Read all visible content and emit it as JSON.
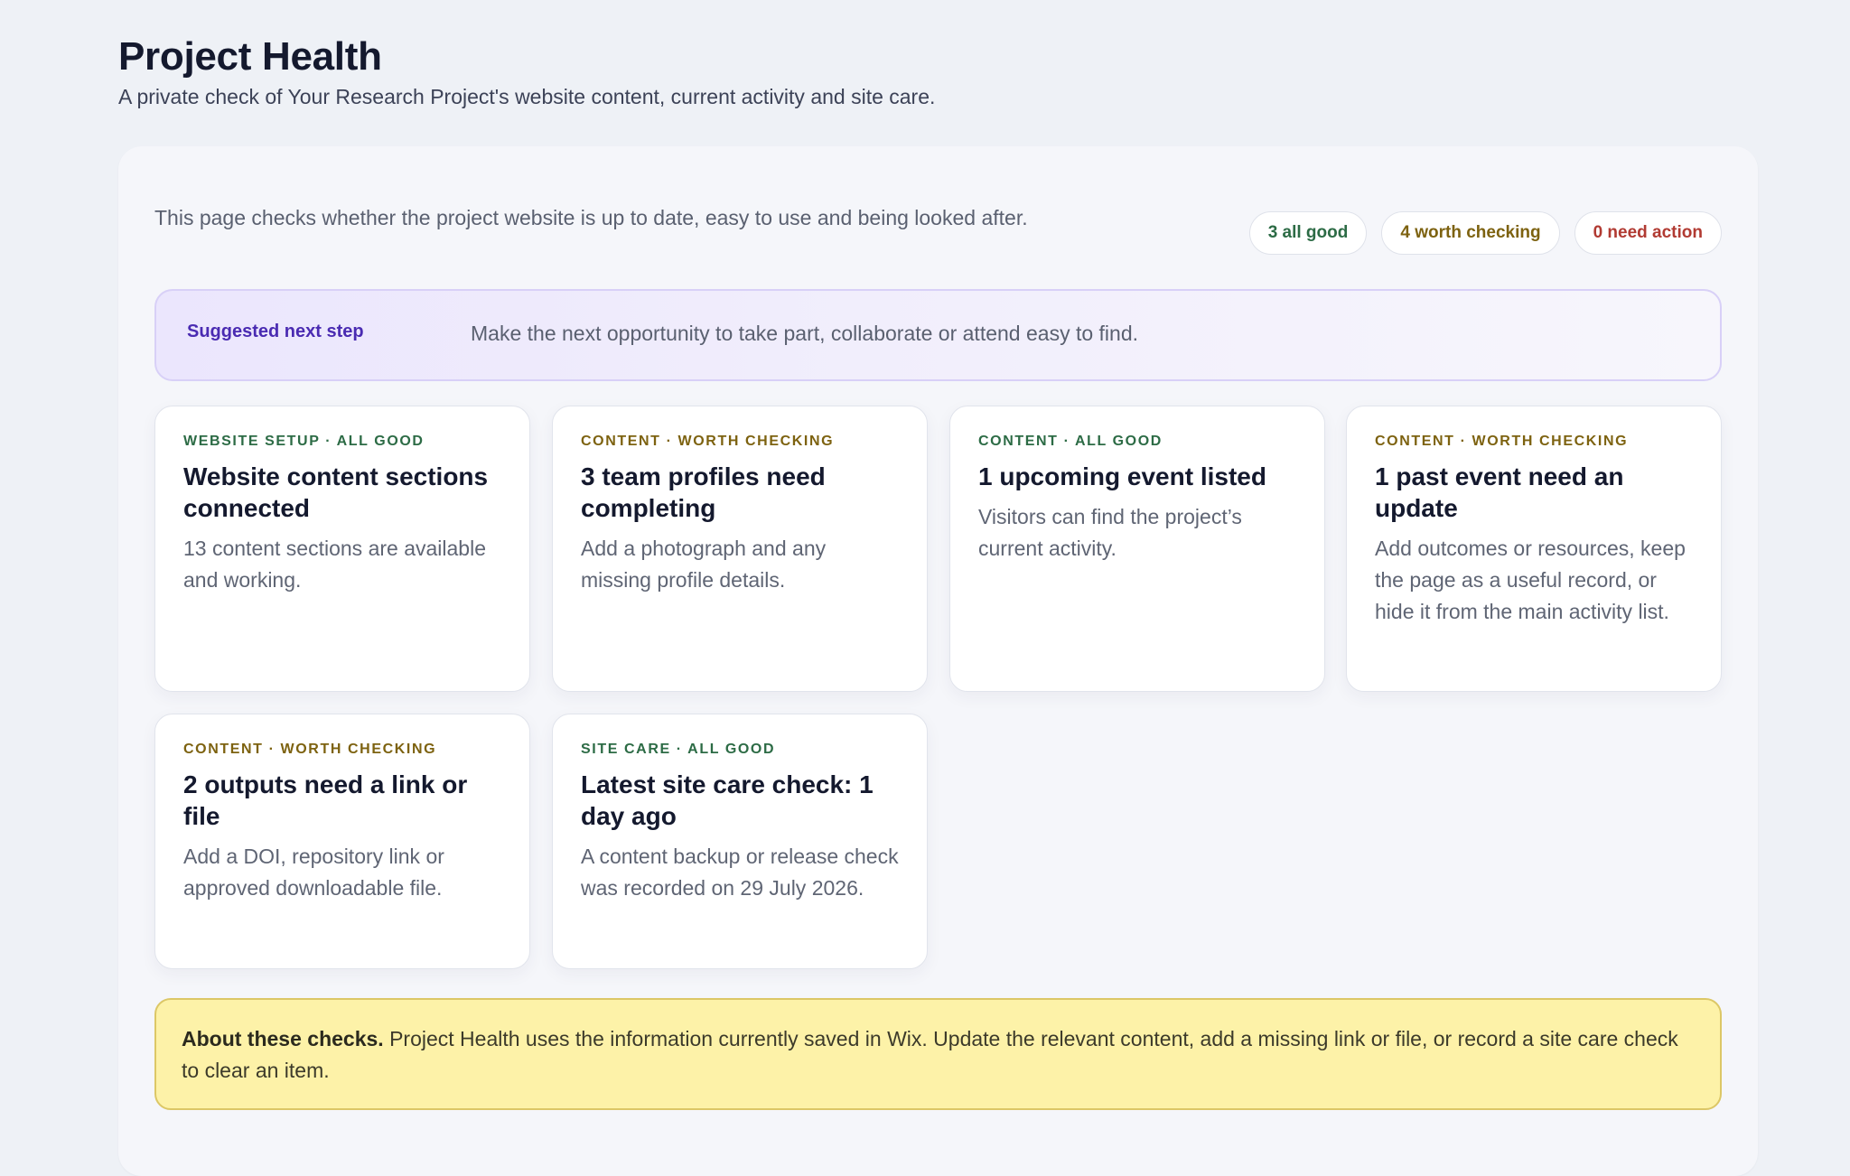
{
  "header": {
    "title": "Project Health",
    "subtitle": "A private check of Your Research Project's website content, current activity and site care."
  },
  "summary": {
    "intro": "This page checks whether the project website is up to date, easy to use and being looked after.",
    "badges": {
      "good": "3 all good",
      "check": "4 worth checking",
      "action": "0 need action"
    }
  },
  "next_step": {
    "label": "Suggested next step",
    "text": "Make the next opportunity to take part, collaborate or attend easy to find."
  },
  "cards": [
    {
      "tag": "WEBSITE SETUP · ALL GOOD",
      "status": "good",
      "title": "Website content sections connected",
      "text": "13 content sections are available and working."
    },
    {
      "tag": "CONTENT · WORTH CHECKING",
      "status": "check",
      "title": "3 team profiles need completing",
      "text": "Add a photograph and any missing profile details."
    },
    {
      "tag": "CONTENT · ALL GOOD",
      "status": "good",
      "title": "1 upcoming event listed",
      "text": "Visitors can find the project’s current activity."
    },
    {
      "tag": "CONTENT · WORTH CHECKING",
      "status": "check",
      "title": "1 past event need an update",
      "text": "Add outcomes or resources, keep the page as a useful record, or hide it from the main activity list."
    },
    {
      "tag": "CONTENT · WORTH CHECKING",
      "status": "check",
      "title": "2 outputs need a link or file",
      "text": "Add a DOI, repository link or approved downloadable file."
    },
    {
      "tag": "SITE CARE · ALL GOOD",
      "status": "good",
      "title": "Latest site care check: 1 day ago",
      "text": "A content backup or release check was recorded on 29 July 2026."
    }
  ],
  "note": {
    "strong": "About these checks.",
    "text": " Project Health uses the information currently saved in Wix. Update the relevant content, add a missing link or file, or record a site care check to clear an item."
  },
  "colors": {
    "good": "#2c6b45",
    "check": "#7d6210",
    "action": "#b13a32",
    "accent": "#4a2bb2",
    "note_bg": "#fdf2a8"
  }
}
